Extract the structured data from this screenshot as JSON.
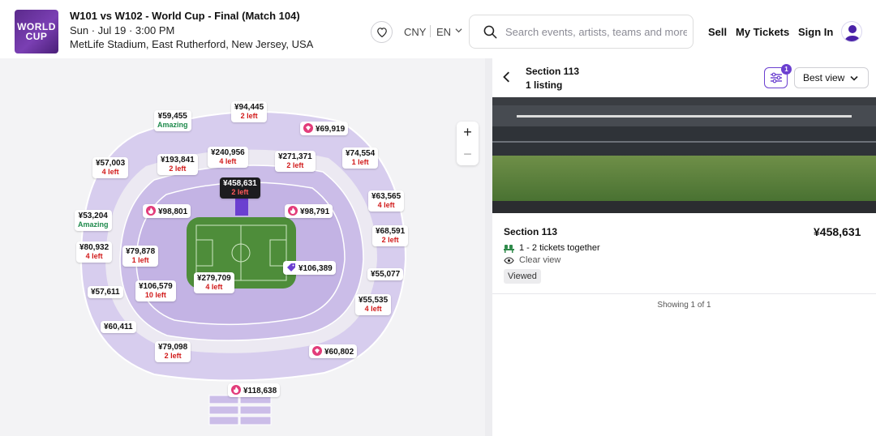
{
  "header": {
    "logo_line1": "WORLD",
    "logo_line2": "CUP",
    "title": "W101 vs W102 - World Cup - Final (Match 104)",
    "date": "Sun · Jul 19 · 3:00 PM",
    "venue": "MetLife Stadium, East Rutherford, New Jersey, USA",
    "currency": "CNY",
    "language": "EN",
    "search_placeholder": "Search events, artists, teams and more",
    "nav": {
      "sell": "Sell",
      "my_tickets": "My Tickets",
      "sign_in": "Sign In"
    }
  },
  "map": {
    "zoom_in": "+",
    "zoom_out": "−",
    "price_labels": [
      {
        "price": "¥59,455",
        "sub": "Amazing",
        "sub_color": "green"
      },
      {
        "price": "¥94,445",
        "sub": "2 left",
        "sub_color": "red"
      },
      {
        "price": "¥69,919",
        "icon": "gem-icon"
      },
      {
        "price": "¥57,003",
        "sub": "4 left",
        "sub_color": "red"
      },
      {
        "price": "¥193,841",
        "sub": "2 left",
        "sub_color": "red"
      },
      {
        "price": "¥240,956",
        "sub": "4 left",
        "sub_color": "red"
      },
      {
        "price": "¥271,371",
        "sub": "2 left",
        "sub_color": "red"
      },
      {
        "price": "¥74,554",
        "sub": "1 left",
        "sub_color": "red"
      },
      {
        "price": "¥458,631",
        "sub": "2 left",
        "selected": true
      },
      {
        "price": "¥63,565",
        "sub": "4 left",
        "sub_color": "red"
      },
      {
        "price": "¥53,204",
        "sub": "Amazing",
        "sub_color": "green"
      },
      {
        "price": "¥98,801",
        "icon": "flame-icon"
      },
      {
        "price": "¥98,791",
        "icon": "flame-icon"
      },
      {
        "price": "¥68,591",
        "sub": "2 left",
        "sub_color": "red"
      },
      {
        "price": "¥80,932",
        "sub": "4 left",
        "sub_color": "red"
      },
      {
        "price": "¥79,878",
        "sub": "1 left",
        "sub_color": "red"
      },
      {
        "price": "¥106,389",
        "icon": "tag-icon"
      },
      {
        "price": "¥55,077"
      },
      {
        "price": "¥279,709",
        "sub": "4 left",
        "sub_color": "red"
      },
      {
        "price": "¥106,579",
        "sub": "10 left",
        "sub_color": "red"
      },
      {
        "price": "¥57,611"
      },
      {
        "price": "¥55,535",
        "sub": "4 left",
        "sub_color": "red"
      },
      {
        "price": "¥60,411"
      },
      {
        "price": "¥79,098",
        "sub": "2 left",
        "sub_color": "red"
      },
      {
        "price": "¥60,802",
        "icon": "gem-icon"
      },
      {
        "price": "¥118,638",
        "icon": "flame-icon"
      }
    ]
  },
  "panel": {
    "section_title": "Section 113",
    "listing_count": "1 listing",
    "filter_badge": "1",
    "sort_label": "Best view",
    "listing": {
      "section": "Section 113",
      "price": "¥458,631",
      "tickets": "1 - 2 tickets together",
      "view": "Clear view",
      "badge": "Viewed"
    },
    "showing": "Showing 1 of 1"
  },
  "colors": {
    "accent": "#6b3fd0",
    "seat": "#cbbde8",
    "seat_selected": "#6b3fd0",
    "pitch": "#4e8d3a",
    "left_text": "#d11a1a",
    "amazing_text": "#1f8a4c"
  }
}
